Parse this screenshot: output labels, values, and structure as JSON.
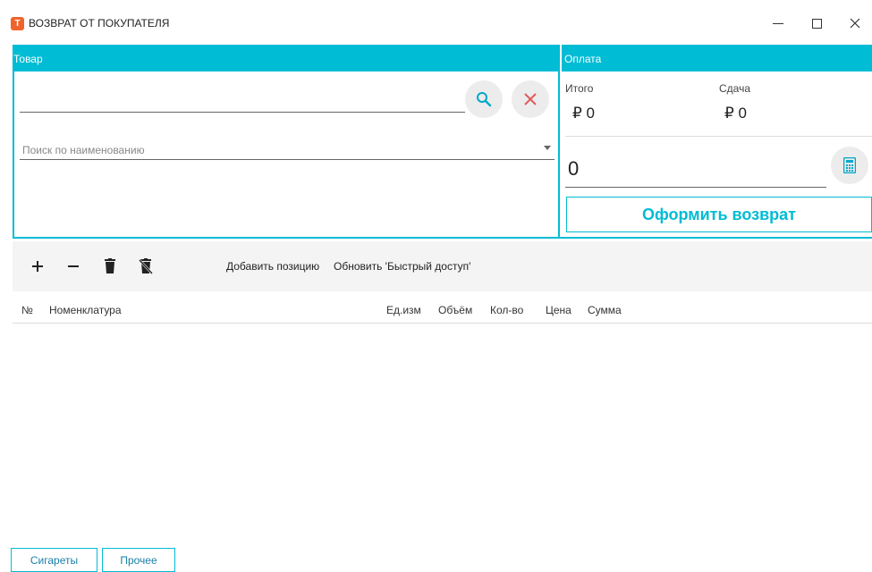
{
  "window": {
    "title": "ВОЗВРАТ ОТ ПОКУПАТЕЛЯ",
    "app_icon_letter": "Т"
  },
  "goods": {
    "header": "Товар",
    "barcode_value": "",
    "name_search_placeholder": "Поиск по наименованию"
  },
  "payment": {
    "header": "Оплата",
    "total_label": "Итого",
    "total_value": "₽ 0",
    "change_label": "Сдача",
    "change_value": "₽ 0",
    "amount_value": "0",
    "submit_label": "Оформить возврат"
  },
  "toolbar": {
    "add_position_label": "Добавить позицию",
    "refresh_quick_access_label": "Обновить 'Быстрый доступ'"
  },
  "table": {
    "columns": [
      "№",
      "Номенклатура",
      "Ед.изм",
      "Объём",
      "Кол-во",
      "Цена",
      "Сумма"
    ],
    "rows": []
  },
  "quick_access": {
    "buttons": [
      "Сигареты",
      "Прочее"
    ]
  },
  "colors": {
    "accent": "#00bcd4",
    "app_icon": "#f0632a",
    "clear_icon": "#e05a5a",
    "search_icon": "#00a8c8"
  }
}
